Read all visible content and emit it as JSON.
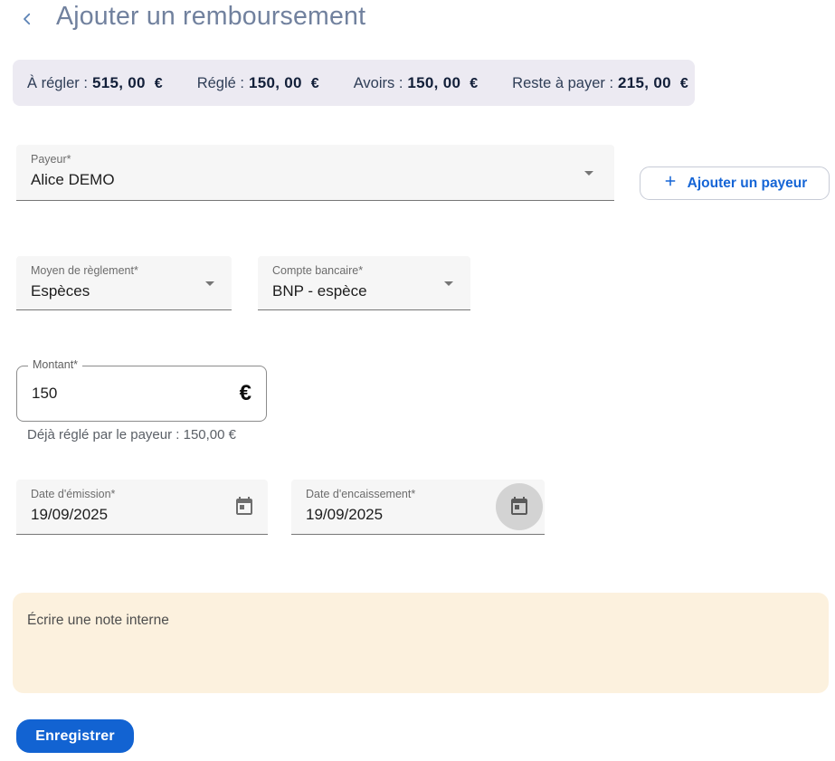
{
  "header": {
    "back_icon": "chevron-left",
    "title": "Ajouter un remboursement"
  },
  "summary": {
    "items": [
      {
        "label": "À régler :",
        "amount": "515, 00",
        "currency": "€"
      },
      {
        "label": "Réglé :",
        "amount": "150, 00",
        "currency": "€"
      },
      {
        "label": "Avoirs :",
        "amount": "150, 00",
        "currency": "€"
      },
      {
        "label": "Reste à payer :",
        "amount": "215, 00",
        "currency": "€"
      }
    ]
  },
  "form": {
    "payer": {
      "label": "Payeur*",
      "value": "Alice DEMO"
    },
    "add_payer_button": {
      "plus": "+",
      "label": "Ajouter un payeur"
    },
    "payment_method": {
      "label": "Moyen de règlement*",
      "value": "Espèces"
    },
    "bank_account": {
      "label": "Compte bancaire*",
      "value": "BNP - espèce"
    },
    "amount": {
      "label": "Montant*",
      "value": "150",
      "currency": "€",
      "helper": "Déjà réglé par le payeur : 150,00 €"
    },
    "issue_date": {
      "label": "Date d'émission*",
      "value": "19/09/2025"
    },
    "collection_date": {
      "label": "Date d'encaissement*",
      "value": "19/09/2025"
    },
    "note": {
      "placeholder": "Écrire une note interne",
      "value": ""
    }
  },
  "actions": {
    "save_label": "Enregistrer"
  },
  "colors": {
    "accent": "#1565D6",
    "button_blue": "#1263D2",
    "summary_bg": "#ECEAF2",
    "note_bg": "#FCF1DE",
    "title_color": "#71819E"
  }
}
